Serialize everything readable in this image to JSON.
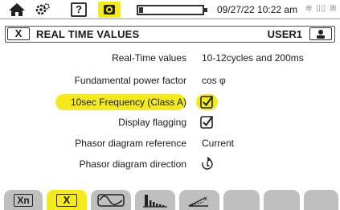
{
  "statusbar": {
    "home_icon": "home-icon",
    "settings_icon": "gear-icon",
    "help_label": "?",
    "screenshot_icon": "camera-icon",
    "battery_level": 0.06,
    "datetime": "09/27/22 10:22 am",
    "status_icons": "⊕ ▯▯ ⊞"
  },
  "titlebar": {
    "close_label": "X",
    "title": "REAL TIME VALUES",
    "user": "USER1"
  },
  "settings": [
    {
      "label": "Real-Time values",
      "value": "10-12cycles and 200ms",
      "type": "text",
      "selected": false
    },
    {
      "label": "Fundamental power factor",
      "value": "cos φ",
      "type": "text",
      "selected": false
    },
    {
      "label": "10sec Frequency (Class A)",
      "value": "",
      "type": "checkbox",
      "checked": true,
      "selected": true
    },
    {
      "label": "Display flagging",
      "value": "",
      "type": "checkbox",
      "checked": true,
      "selected": false
    },
    {
      "label": "Phasor diagram reference",
      "value": "Current",
      "type": "text",
      "selected": false
    },
    {
      "label": "Phasor diagram direction",
      "value": "",
      "type": "icon",
      "icon": "rotation-direction-icon",
      "selected": false
    }
  ],
  "tabs": [
    {
      "label": "Xn",
      "icon": "",
      "active": false
    },
    {
      "label": "X",
      "icon": "",
      "active": true
    },
    {
      "label": "",
      "icon": "waveform-icon",
      "active": false
    },
    {
      "label": "",
      "icon": "harmonics-icon",
      "active": false
    },
    {
      "label": "",
      "icon": "phasor-icon",
      "active": false
    },
    {
      "label": "",
      "icon": "",
      "active": false
    },
    {
      "label": "",
      "icon": "",
      "active": false
    },
    {
      "label": "",
      "icon": "",
      "active": false
    }
  ],
  "colors": {
    "highlight": "#f5ea1e",
    "tab_inactive": "#bfbfbf",
    "text": "#1a1a1a"
  }
}
